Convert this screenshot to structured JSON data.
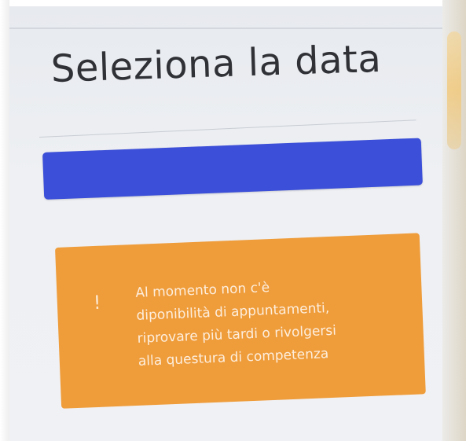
{
  "header": {
    "title": "Seleziona la data"
  },
  "alert": {
    "icon": "!",
    "icon_name": "exclamation-icon",
    "lines": [
      "Al momento non c'è",
      "diponibilità di appuntamenti,",
      "riprovare più tardi o rivolgersi",
      "alla questura di competenza"
    ]
  },
  "colors": {
    "primary_bar": "#3b4fd8",
    "alert_background": "#ef9c3a",
    "alert_text": "#fdeedd"
  }
}
